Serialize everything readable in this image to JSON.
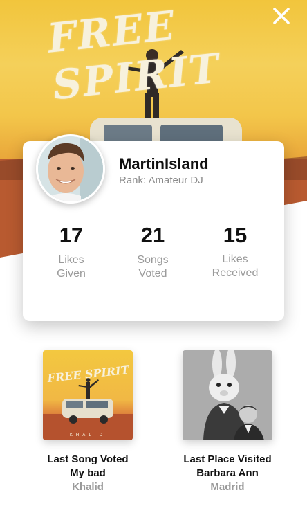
{
  "hero": {
    "artwork_text": "FREE SPIRIT",
    "close_icon": "close-icon"
  },
  "profile": {
    "username": "MartinIsland",
    "rank": "Rank: Amateur DJ",
    "avatar_icon": "user-avatar"
  },
  "stats": [
    {
      "value": "17",
      "label_line1": "Likes",
      "label_line2": "Given"
    },
    {
      "value": "21",
      "label_line1": "Songs",
      "label_line2": "Voted"
    },
    {
      "value": "15",
      "label_line1": "Likes",
      "label_line2": "Received"
    }
  ],
  "tiles": [
    {
      "title": "Last Song Voted",
      "primary": "My bad",
      "secondary": "Khalid",
      "cover_text": "FREE SPIRIT",
      "cover_artist": "KHALID"
    },
    {
      "title": "Last Place Visited",
      "primary": "Barbara Ann",
      "secondary": "Madrid"
    }
  ],
  "colors": {
    "sky_yellow": "#f2c53c",
    "sunset_orange": "#d9773a",
    "card_bg": "#ffffff",
    "muted_text": "#9a9a9a"
  }
}
